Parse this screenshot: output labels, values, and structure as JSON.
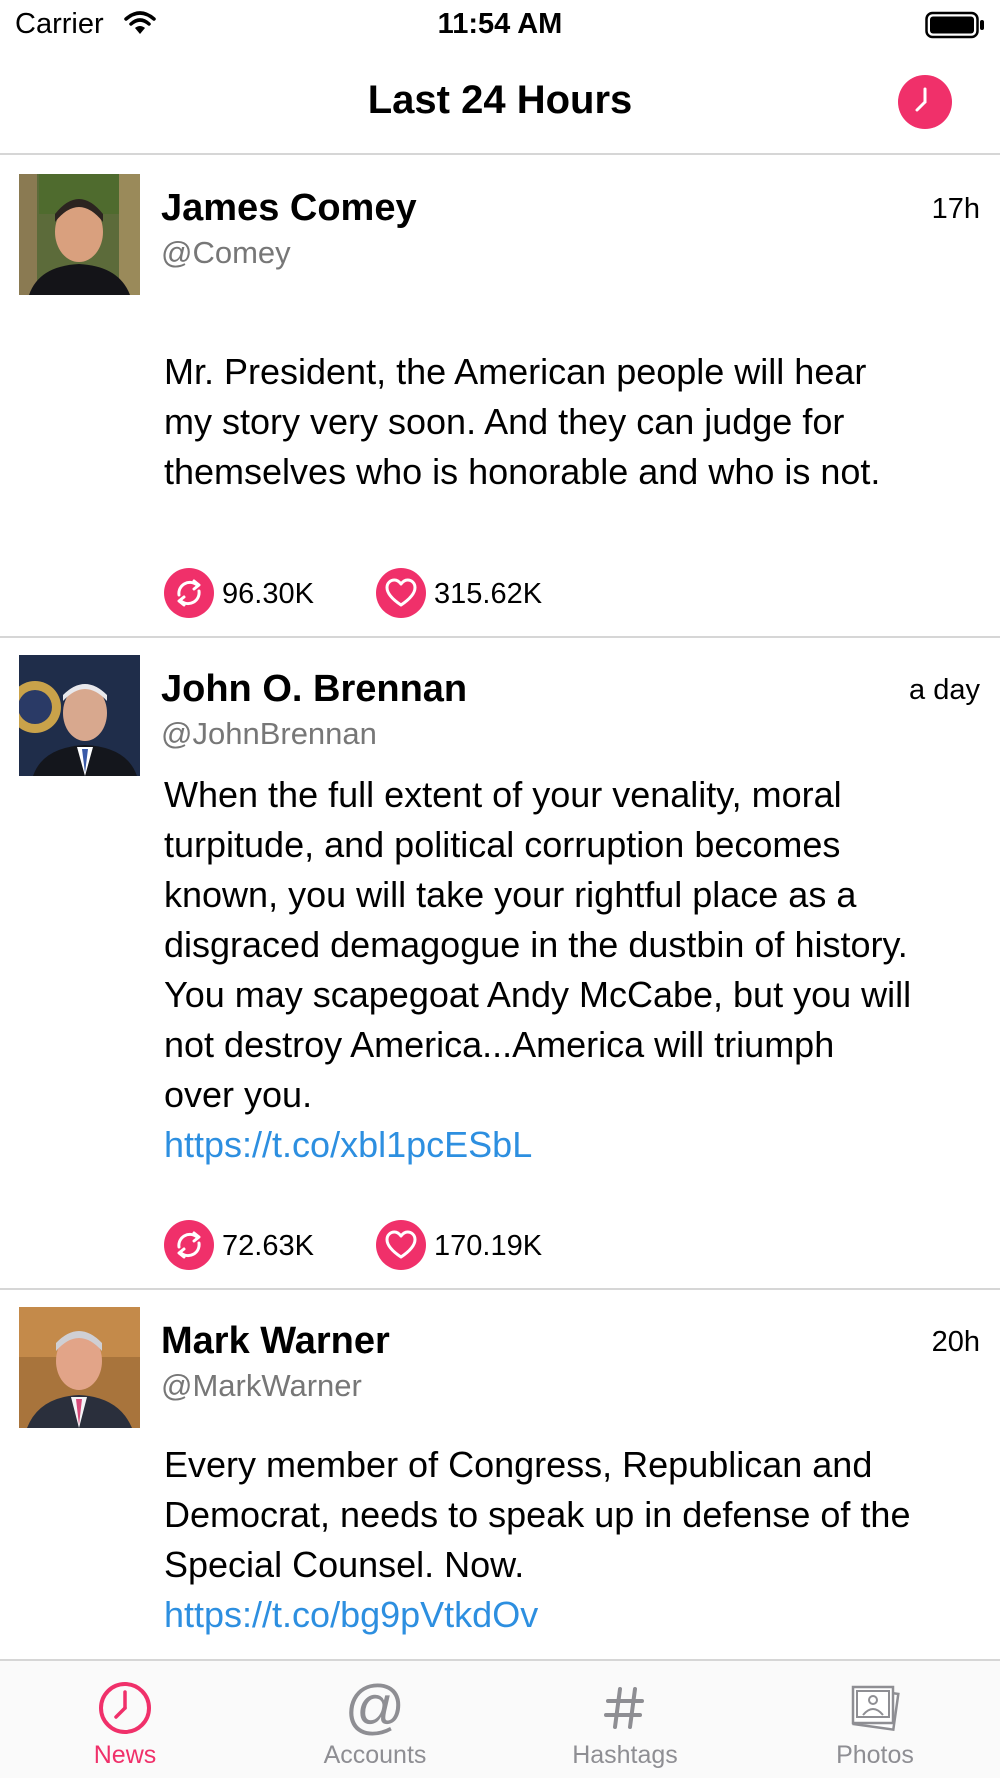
{
  "status_bar": {
    "carrier": "Carrier",
    "time": "11:54 AM"
  },
  "nav": {
    "title": "Last 24 Hours",
    "right_icon": "clock-icon"
  },
  "tweets": [
    {
      "name": "James Comey",
      "handle": "@Comey",
      "time": "17h",
      "lines": [
        "Mr. President, the American people will hear",
        "my story very soon. And they can judge for",
        "themselves who is honorable and who is not."
      ],
      "link": "",
      "retweets": "96.30K",
      "likes": "315.62K"
    },
    {
      "name": "John O. Brennan",
      "handle": "@JohnBrennan",
      "time": "a day",
      "lines": [
        "When the full extent of your venality, moral",
        "turpitude, and political corruption becomes",
        "known, you will take your rightful place as a",
        "disgraced demagogue in the dustbin of history.",
        "You may scapegoat Andy McCabe, but you will",
        "not destroy America...America will triumph",
        "over you."
      ],
      "link": "https://t.co/xbl1pcESbL",
      "retweets": "72.63K",
      "likes": "170.19K"
    },
    {
      "name": "Mark Warner",
      "handle": "@MarkWarner",
      "time": "20h",
      "lines": [
        "Every member of Congress, Republican and",
        "Democrat, needs to speak up in defense of the",
        "Special Counsel. Now."
      ],
      "link": "https://t.co/bg9pVtkdOv"
    }
  ],
  "tabs": [
    {
      "label": "News",
      "icon": "clock-icon",
      "active": true
    },
    {
      "label": "Accounts",
      "icon": "at-sign-icon",
      "active": false
    },
    {
      "label": "Hashtags",
      "icon": "hashtag-icon",
      "active": false
    },
    {
      "label": "Photos",
      "icon": "photos-icon",
      "active": false
    }
  ],
  "colors": {
    "accent": "#f0306a",
    "link": "#2d8fe0",
    "divider": "#d6d6d6",
    "inactive_tab": "#8e8e93"
  }
}
